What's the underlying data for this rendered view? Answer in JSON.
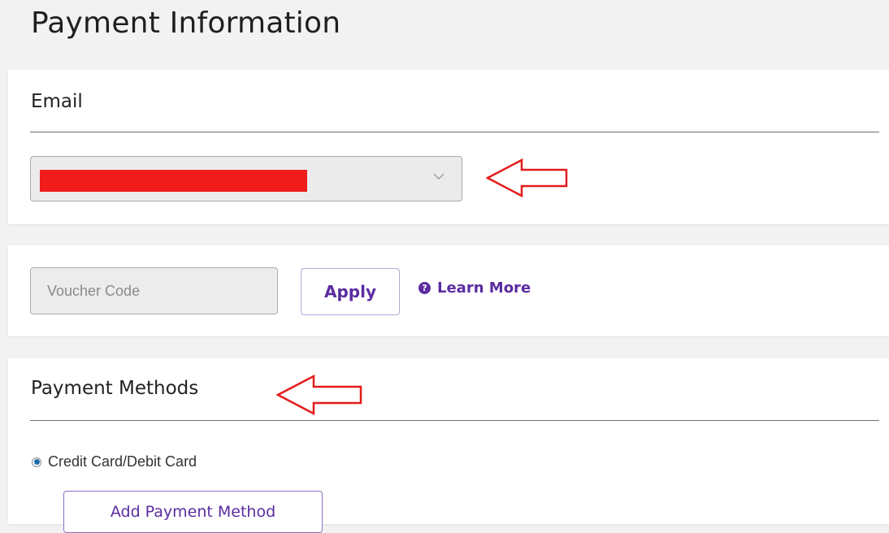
{
  "page": {
    "title": "Payment Information"
  },
  "email_section": {
    "heading": "Email",
    "select_value": "",
    "redaction_color": "#f01c1c"
  },
  "voucher_section": {
    "input_placeholder": "Voucher Code",
    "apply_label": "Apply",
    "learn_more_label": "Learn More",
    "help_icon_glyph": "?"
  },
  "payment_section": {
    "heading": "Payment Methods",
    "options": [
      {
        "label": "Credit Card/Debit Card",
        "selected": true
      }
    ],
    "add_button_label": "Add Payment Method"
  },
  "annotations": {
    "arrow_color": "#e31b1b",
    "icon": "left-arrow-icon"
  },
  "colors": {
    "accent": "#5a2ca0",
    "radio_selected": "#1e6fa8"
  }
}
